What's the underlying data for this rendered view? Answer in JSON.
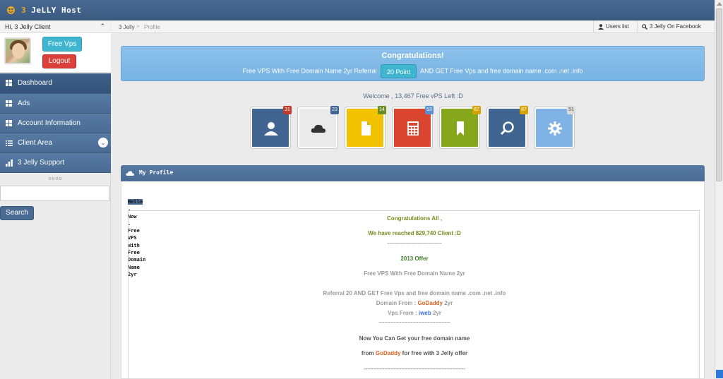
{
  "brand": {
    "number": "3",
    "name": "JeLLY Host"
  },
  "sidebar": {
    "greeting": "Hi, 3 Jelly Client",
    "free_vps_label": "Free Vps",
    "logout_label": "Logout",
    "items": [
      {
        "label": "Dashboard",
        "icon": "grid-icon"
      },
      {
        "label": "Ads",
        "icon": "grid-icon"
      },
      {
        "label": "Account Information",
        "icon": "grid-icon"
      },
      {
        "label": "Client Area",
        "icon": "list-icon"
      },
      {
        "label": "3 Jelly Support",
        "icon": "bar-chart-icon"
      }
    ],
    "search_value": "",
    "search_label": "Search"
  },
  "breadcrumb": {
    "home": "3 Jelly",
    "separator": ">",
    "current": "Profile"
  },
  "header_links": {
    "users": "Users list",
    "facebook": "3 Jelly On Facebook"
  },
  "banner": {
    "title": "Congratulations!",
    "before": "Free VPS With Free Domain Name 2yr Referral",
    "pill": "20 Point",
    "after": "AND GET Free Vps and free domain name .com .net .info"
  },
  "welcome": "Welcome , 13,467 Free vPS Left :D",
  "tiles": [
    {
      "icon": "user-icon",
      "count": "31",
      "bg": "#3f6590",
      "badge": "#c0392b"
    },
    {
      "icon": "cloud-icon",
      "count": "23",
      "bg": "#eaeaea",
      "badge": "#3f6590"
    },
    {
      "icon": "file-icon",
      "count": "14",
      "bg": "#f2c200",
      "badge": "#6b8e23"
    },
    {
      "icon": "calculator-icon",
      "count": "53",
      "bg": "#d9452f",
      "badge": "#5b8fcf"
    },
    {
      "icon": "bookmark-icon",
      "count": "87",
      "bg": "#86a61c",
      "badge": "#d6a300"
    },
    {
      "icon": "search-icon",
      "count": "87",
      "bg": "#3f6590",
      "badge": "#d6a300"
    },
    {
      "icon": "gear-icon",
      "count": "51",
      "bg": "#7fb3e6",
      "badge": "#dcdcdc"
    }
  ],
  "profile": {
    "title": "My Profile",
    "left_words": [
      "Hello",
      ".",
      "Now",
      ".",
      "Free",
      "VPS",
      "With",
      "Free",
      "Domain",
      "Name",
      "2yr"
    ],
    "line1": "Congratulations All ,",
    "line2": "We have reached 829,740 Client :D",
    "divider1": "-----------------------------",
    "line3": "2013 Offer",
    "line4": "Free VPS With Free Domain Name 2yr",
    "line5": "Referral 20 AND GET Free Vps and free domain name .com .net .info",
    "domain_prefix": "Domain From :",
    "domain_brand": "GoDaddy",
    "domain_suffix": "2yr",
    "vps_prefix": "Vps From :",
    "vps_brand": "iweb",
    "vps_suffix": "2yr",
    "divider2": "--------------------------------------",
    "line6": "Now You Can Get your free domain name",
    "line7_prefix": "from",
    "line7_brand": "GoDaddy",
    "line7_suffix": "for free with 3 Jelly offer",
    "divider3": "------------------------------------------------------"
  }
}
